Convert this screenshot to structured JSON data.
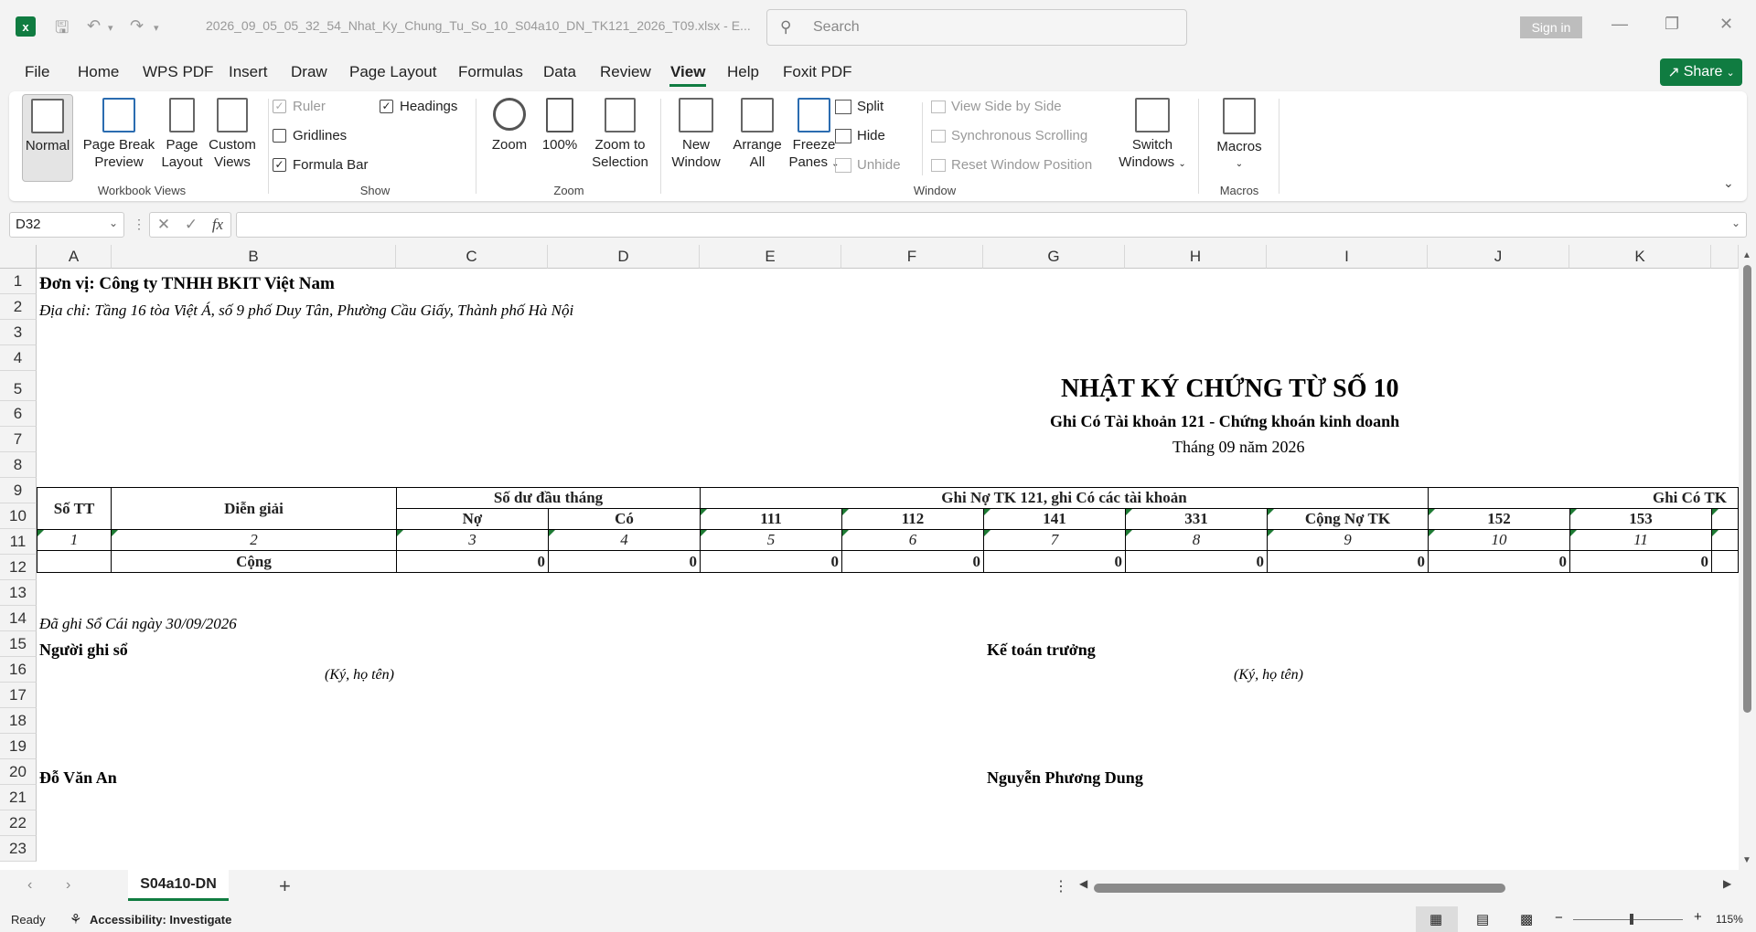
{
  "titlebar": {
    "filename": "2026_09_05_05_32_54_Nhat_Ky_Chung_Tu_So_10_S04a10_DN_TK121_2026_T09.xlsx  -  E...",
    "search_placeholder": "Search",
    "sign_in": "Sign in"
  },
  "menu": {
    "items": [
      "File",
      "Home",
      "WPS PDF",
      "Insert",
      "Draw",
      "Page Layout",
      "Formulas",
      "Data",
      "Review",
      "View",
      "Help",
      "Foxit PDF"
    ],
    "active": "View",
    "share": "Share"
  },
  "ribbon": {
    "workbook_views": {
      "label": "Workbook Views",
      "normal": "Normal",
      "page_break_1": "Page Break",
      "page_break_2": "Preview",
      "page_layout_1": "Page",
      "page_layout_2": "Layout",
      "custom_1": "Custom",
      "custom_2": "Views"
    },
    "show": {
      "label": "Show",
      "ruler": "Ruler",
      "gridlines": "Gridlines",
      "formula_bar": "Formula Bar",
      "headings": "Headings"
    },
    "zoom": {
      "label": "Zoom",
      "zoom": "Zoom",
      "hundred": "100%",
      "to_sel_1": "Zoom to",
      "to_sel_2": "Selection"
    },
    "window": {
      "label": "Window",
      "new_1": "New",
      "new_2": "Window",
      "arrange_1": "Arrange",
      "arrange_2": "All",
      "freeze_1": "Freeze",
      "freeze_2": "Panes",
      "split": "Split",
      "hide": "Hide",
      "unhide": "Unhide",
      "side_by_side": "View Side by Side",
      "sync_scroll": "Synchronous Scrolling",
      "reset_pos": "Reset Window Position",
      "switch_1": "Switch",
      "switch_2": "Windows"
    },
    "macros": {
      "label": "Macros",
      "macros": "Macros"
    }
  },
  "formula_bar": {
    "name_box": "D32",
    "fx": "fx",
    "content": ""
  },
  "columns": [
    "A",
    "B",
    "C",
    "D",
    "E",
    "F",
    "G",
    "H",
    "I",
    "J",
    "K"
  ],
  "rows": [
    "1",
    "2",
    "3",
    "4",
    "5",
    "6",
    "7",
    "8",
    "9",
    "10",
    "11",
    "12",
    "13",
    "14",
    "15",
    "16",
    "17",
    "18",
    "19",
    "20",
    "21",
    "22",
    "23"
  ],
  "sheet": {
    "unit": "Đơn vị: Công ty TNHH BKIT Việt Nam",
    "address": "Địa chỉ: Tầng 16 tòa Việt Á, số 9 phố Duy Tân, Phường Cầu Giấy, Thành phố Hà Nội",
    "title": "NHẬT KÝ CHỨNG TỪ SỐ 10",
    "subtitle": "Ghi Có Tài khoản 121 - Chứng khoán kinh doanh",
    "period": "Tháng 09 năm 2026",
    "hdr_so_tt": "Số TT",
    "hdr_dien_giai": "Diễn giải",
    "hdr_so_du": "Số dư đầu tháng",
    "hdr_no": "Nợ",
    "hdr_co": "Có",
    "hdr_ghi_no": "Ghi Nợ TK 121, ghi Có các tài khoản",
    "hdr_ghi_co": "Ghi Có TK",
    "acc_111": "111",
    "acc_112": "112",
    "acc_141": "141",
    "acc_331": "331",
    "acc_cong_no": "Cộng Nợ TK",
    "acc_152": "152",
    "acc_153": "153",
    "idx": [
      "1",
      "2",
      "3",
      "4",
      "5",
      "6",
      "7",
      "8",
      "9",
      "10",
      "11"
    ],
    "total_label": "Cộng",
    "totals": [
      "0",
      "0",
      "0",
      "0",
      "0",
      "0",
      "0",
      "0",
      "0"
    ],
    "recorded": "Đã ghi Sổ Cái ngày 30/09/2026",
    "recorder_title": "Người ghi sổ",
    "sign_hint": "(Ký, họ tên)",
    "chief_title": "Kế toán trưởng",
    "recorder_name": "Đỗ Văn An",
    "chief_name": "Nguyễn Phương Dung"
  },
  "tabs": {
    "active": "S04a10-DN",
    "add": "+"
  },
  "status": {
    "ready": "Ready",
    "accessibility": "Accessibility: Investigate",
    "zoom": "115%"
  }
}
